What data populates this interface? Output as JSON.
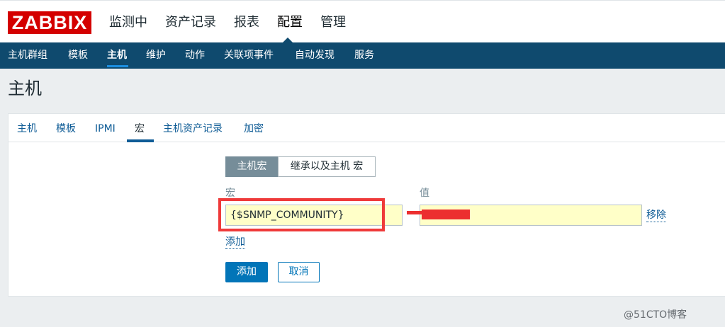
{
  "header": {
    "logo_text": "ZABBIX",
    "nav": [
      "监测中",
      "资产记录",
      "报表",
      "配置",
      "管理"
    ],
    "active_nav": "配置"
  },
  "subnav": {
    "items": [
      "主机群组",
      "模板",
      "主机",
      "维护",
      "动作",
      "关联项事件",
      "自动发现",
      "服务"
    ],
    "active": "主机"
  },
  "page": {
    "title": "主机"
  },
  "tabs": {
    "items": [
      "主机",
      "模板",
      "IPMI",
      "宏",
      "主机资产记录",
      "加密"
    ],
    "active": "宏"
  },
  "macros": {
    "toggle": [
      "主机宏",
      "继承以及主机 宏"
    ],
    "macro_label": "宏",
    "value_label": "值",
    "rows": [
      {
        "macro": "{$SNMP_COMMUNITY}",
        "value": "",
        "remove_label": "移除"
      }
    ],
    "add_link": "添加"
  },
  "buttons": {
    "add": "添加",
    "cancel": "取消"
  },
  "watermark": "@51CTO博客",
  "colors": {
    "brand": "#d40000",
    "nav_bar": "#0f4a6e",
    "primary": "#0275b8",
    "highlight": "#ef3a3a",
    "field_bg": "#ffffc8"
  }
}
